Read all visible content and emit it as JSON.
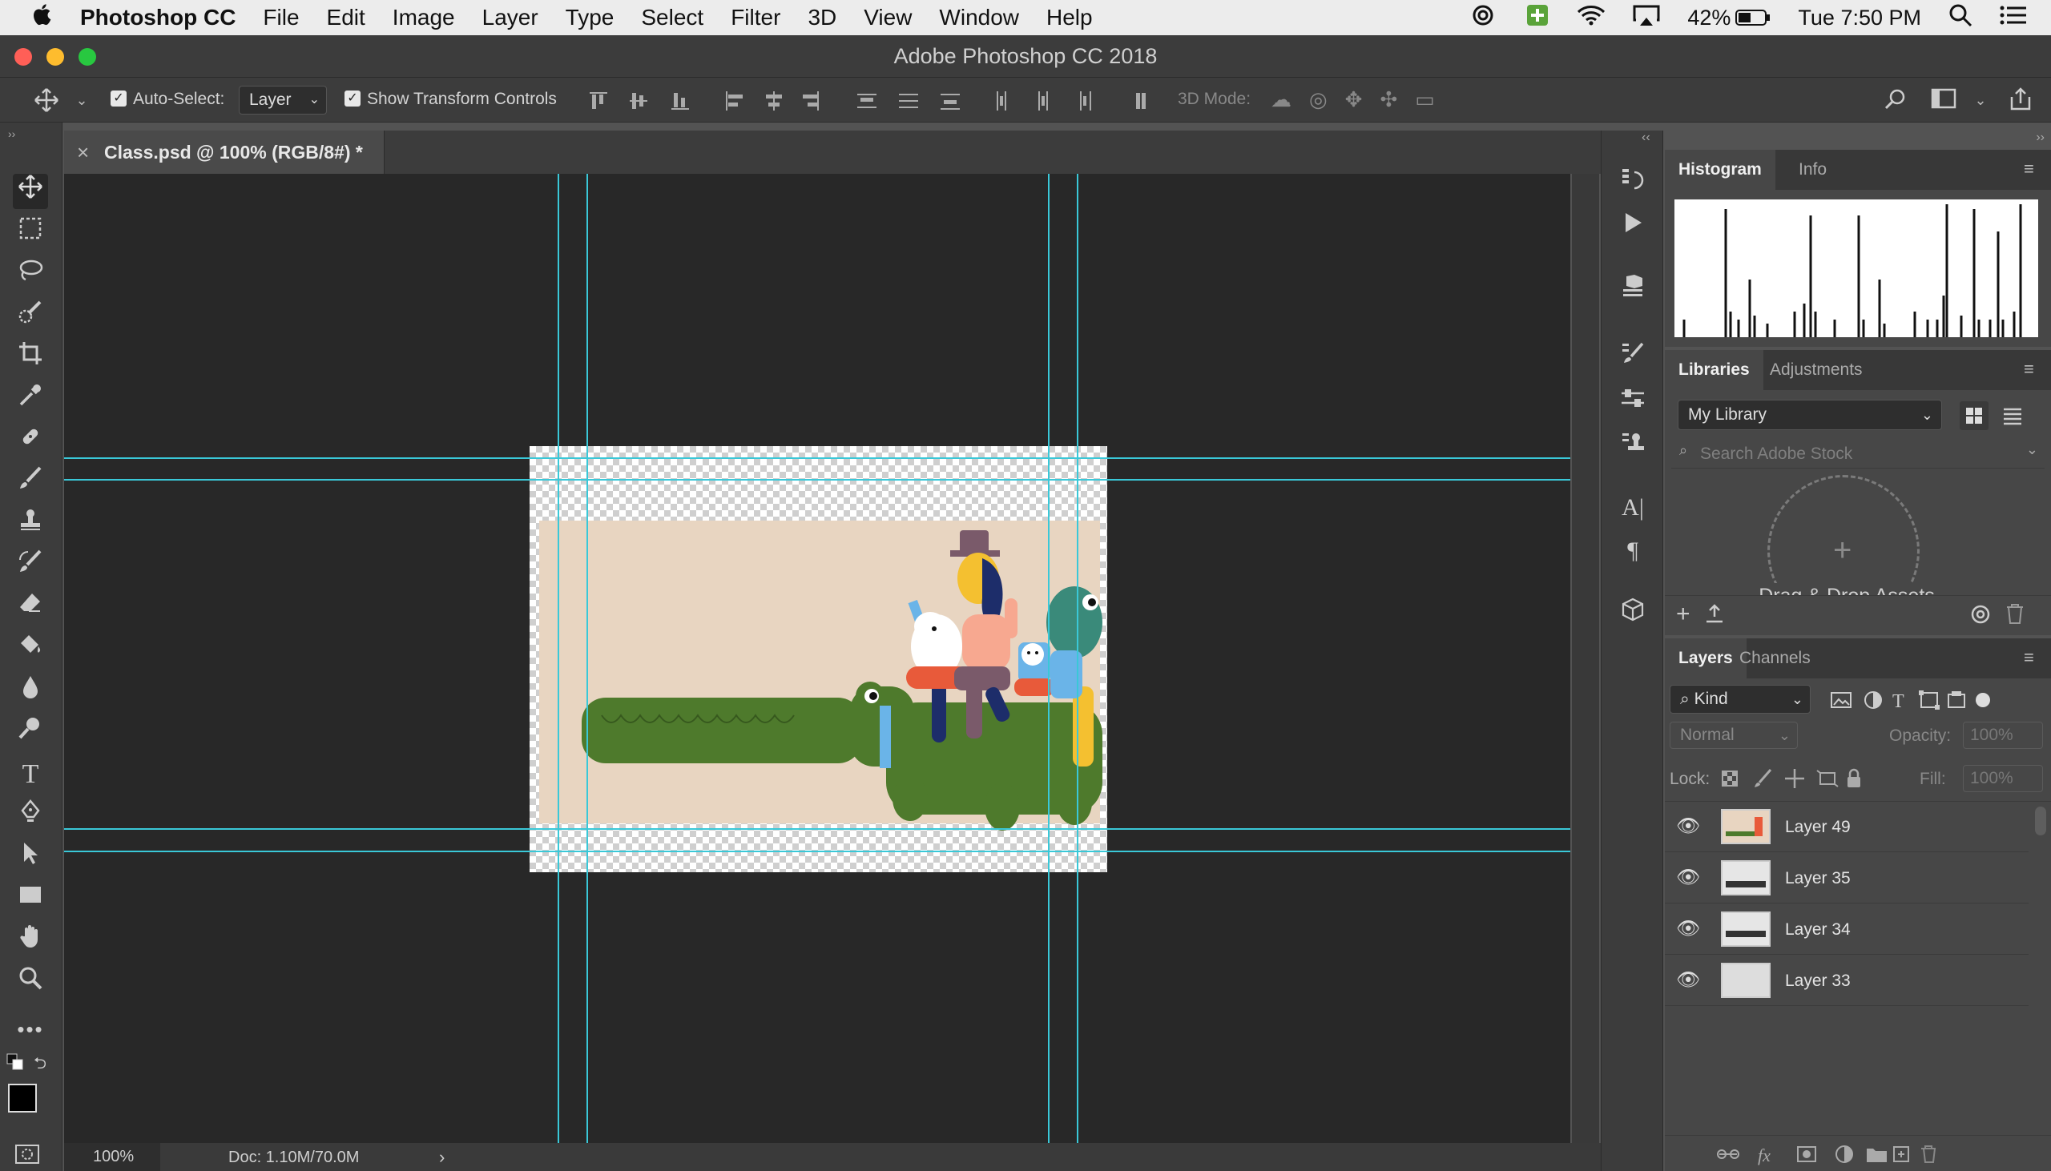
{
  "menubar": {
    "apple": "",
    "app_name": "Photoshop CC",
    "items": [
      "File",
      "Edit",
      "Image",
      "Layer",
      "Type",
      "Select",
      "Filter",
      "3D",
      "View",
      "Window",
      "Help"
    ],
    "battery": "42%",
    "clock": "Tue 7:50 PM"
  },
  "window": {
    "title": "Adobe Photoshop CC 2018"
  },
  "options": {
    "auto_select_label": "Auto-Select:",
    "auto_select_value": "Layer",
    "show_transform_label": "Show Transform Controls",
    "mode_3d_label": "3D Mode:"
  },
  "document": {
    "tab_close": "×",
    "tab_title": "Class.psd @ 100% (RGB/8#) *"
  },
  "status": {
    "zoom": "100%",
    "doc_size": "Doc: 1.10M/70.0M",
    "arrow": "›"
  },
  "panels": {
    "histogram": {
      "tabs": [
        "Histogram",
        "Info"
      ]
    },
    "libraries": {
      "tabs": [
        "Libraries",
        "Adjustments"
      ],
      "library_select": "My Library",
      "search_placeholder": "Search Adobe Stock",
      "drop_text": "Drag & Drop Assets"
    },
    "layers": {
      "tabs": [
        "Layers",
        "Channels"
      ],
      "kind_filter": "Kind",
      "blend_mode": "Normal",
      "opacity_label": "Opacity:",
      "opacity_value": "100%",
      "lock_label": "Lock:",
      "fill_label": "Fill:",
      "fill_value": "100%",
      "layers": [
        "Layer 49",
        "Layer 35",
        "Layer 34",
        "Layer 33"
      ]
    }
  },
  "colors": {
    "guide": "#3ac8d8",
    "artwork_bg": "#e8d5c1",
    "croc_green": "#4e7a2c"
  },
  "icons": {
    "toolbar": [
      "move-tool-icon",
      "marquee-tool-icon",
      "lasso-tool-icon",
      "quick-select-tool-icon",
      "crop-tool-icon",
      "eyedropper-tool-icon",
      "healing-brush-tool-icon",
      "brush-tool-icon",
      "clone-stamp-tool-icon",
      "history-brush-tool-icon",
      "eraser-tool-icon",
      "paint-bucket-tool-icon",
      "blur-tool-icon",
      "dodge-tool-icon",
      "type-tool-icon",
      "pen-tool-icon",
      "path-select-tool-icon",
      "rectangle-tool-icon",
      "hand-tool-icon",
      "zoom-tool-icon",
      "more-tools-icon"
    ]
  }
}
